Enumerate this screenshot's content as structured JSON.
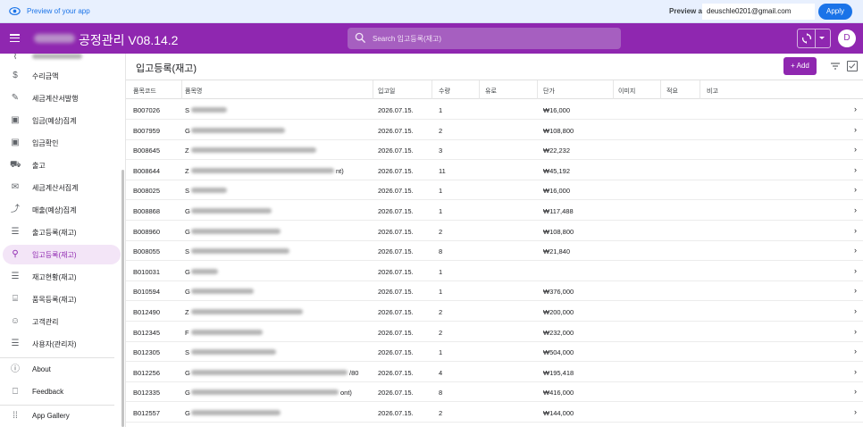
{
  "preview_bar": {
    "text": "Preview of your app",
    "preview_as_label": "Preview as:",
    "email": "deuschle0201@gmail.com",
    "apply_label": "Apply"
  },
  "app_bar": {
    "title": "공정관리 V08.14.2",
    "search_placeholder": "Search 입고등록(재고)",
    "avatar_letter": "D",
    "color": "#8f27b0"
  },
  "sidebar": {
    "items": [
      {
        "label": "",
        "icon": "partial-icon"
      },
      {
        "label": "수리금액",
        "icon": "dollar-icon"
      },
      {
        "label": "세금계산서발행",
        "icon": "edit-note-icon"
      },
      {
        "label": "입금(예상)집계",
        "icon": "money-icon"
      },
      {
        "label": "입금확인",
        "icon": "money-icon"
      },
      {
        "label": "출고",
        "icon": "truck-icon"
      },
      {
        "label": "세금계산서집계",
        "icon": "mail-icon"
      },
      {
        "label": "매출(예상)집계",
        "icon": "trending-icon"
      },
      {
        "label": "출고등록(재고)",
        "icon": "list-icon"
      },
      {
        "label": "입고등록(재고)",
        "icon": "hierarchy-icon",
        "active": true
      },
      {
        "label": "재고현황(재고)",
        "icon": "list-icon"
      },
      {
        "label": "품목등록(재고)",
        "icon": "desk-icon"
      },
      {
        "label": "고객관리",
        "icon": "person-icon"
      },
      {
        "label": "사용자(관리자)",
        "icon": "list-icon"
      }
    ],
    "footer": [
      {
        "label": "About",
        "icon": "info-icon"
      },
      {
        "label": "Feedback",
        "icon": "feedback-icon"
      },
      {
        "label": "App Gallery",
        "icon": "grid-icon"
      }
    ]
  },
  "main": {
    "page_title": "입고등록(재고)",
    "add_label": "+ Add",
    "columns": [
      "품목코드",
      "품목명",
      "입고일",
      "수량",
      "유로",
      "단가",
      "이미지",
      "적요",
      "비고"
    ],
    "rows": [
      {
        "code": "B007026",
        "name_prefix": "S",
        "name_suffix": "",
        "date": "2026.07.15.",
        "qty": "1",
        "price": "₩16,000"
      },
      {
        "code": "B007959",
        "name_prefix": "G",
        "name_suffix": "",
        "date": "2026.07.15.",
        "qty": "2",
        "price": "₩108,800"
      },
      {
        "code": "B008645",
        "name_prefix": "Z",
        "name_suffix": "",
        "date": "2026.07.15.",
        "qty": "3",
        "price": "₩22,232"
      },
      {
        "code": "B008644",
        "name_prefix": "Z",
        "name_suffix": "nt)",
        "date": "2026.07.15.",
        "qty": "11",
        "price": "₩45,192"
      },
      {
        "code": "B008025",
        "name_prefix": "S",
        "name_suffix": "",
        "date": "2026.07.15.",
        "qty": "1",
        "price": "₩16,000"
      },
      {
        "code": "B008868",
        "name_prefix": "G",
        "name_suffix": "",
        "date": "2026.07.15.",
        "qty": "1",
        "price": "₩117,488"
      },
      {
        "code": "B008960",
        "name_prefix": "G",
        "name_suffix": "",
        "date": "2026.07.15.",
        "qty": "2",
        "price": "₩108,800"
      },
      {
        "code": "B008055",
        "name_prefix": "S",
        "name_suffix": "",
        "date": "2026.07.15.",
        "qty": "8",
        "price": "₩21,840"
      },
      {
        "code": "B010031",
        "name_prefix": "G",
        "name_suffix": "",
        "date": "2026.07.15.",
        "qty": "1",
        "price": ""
      },
      {
        "code": "B010594",
        "name_prefix": "G",
        "name_suffix": "",
        "date": "2026.07.15.",
        "qty": "1",
        "price": "₩376,000"
      },
      {
        "code": "B012490",
        "name_prefix": "Z",
        "name_suffix": "",
        "date": "2026.07.15.",
        "qty": "2",
        "price": "₩200,000"
      },
      {
        "code": "B012345",
        "name_prefix": "F",
        "name_suffix": "",
        "date": "2026.07.15.",
        "qty": "2",
        "price": "₩232,000"
      },
      {
        "code": "B012305",
        "name_prefix": "S",
        "name_suffix": "",
        "date": "2026.07.15.",
        "qty": "1",
        "price": "₩504,000"
      },
      {
        "code": "B012256",
        "name_prefix": "G",
        "name_suffix": "/80",
        "date": "2026.07.15.",
        "qty": "4",
        "price": "₩195,418"
      },
      {
        "code": "B012335",
        "name_prefix": "G",
        "name_suffix": "ont)",
        "date": "2026.07.15.",
        "qty": "8",
        "price": "₩416,000"
      },
      {
        "code": "B012557",
        "name_prefix": "G",
        "name_suffix": "",
        "date": "2026.07.15.",
        "qty": "2",
        "price": "₩144,000"
      }
    ]
  }
}
